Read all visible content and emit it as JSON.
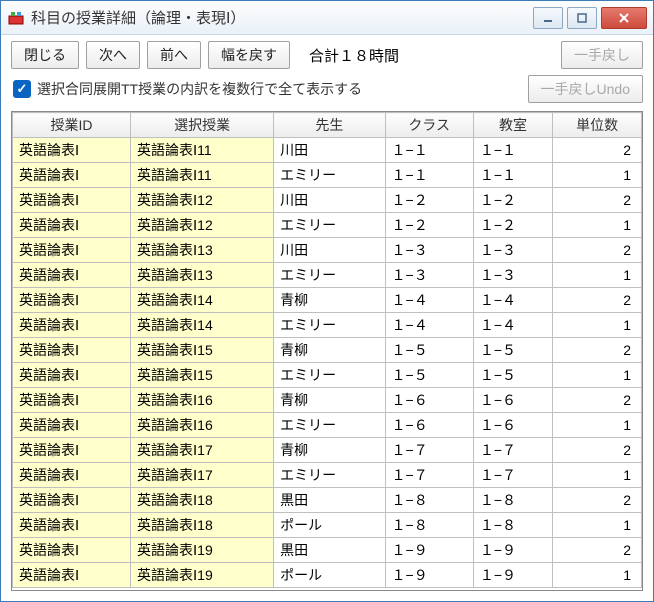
{
  "window": {
    "title": "科目の授業詳細（論理・表現Ⅰ）"
  },
  "toolbar": {
    "close": "閉じる",
    "next": "次へ",
    "prev": "前へ",
    "reset_width": "幅を戻す",
    "summary": "合計１８時間",
    "undo1": "一手戻し",
    "undo2": "一手戻しUndo"
  },
  "checkbox": {
    "label": "選択合同展開TT授業の内訳を複数行で全て表示する"
  },
  "table": {
    "headers": [
      "授業ID",
      "選択授業",
      "先生",
      "クラス",
      "教室",
      "単位数"
    ],
    "rows": [
      [
        "英語論表Ⅰ",
        "英語論表Ⅰ11",
        "川田",
        "１−１",
        "１−１",
        "2"
      ],
      [
        "英語論表Ⅰ",
        "英語論表Ⅰ11",
        "エミリー",
        "１−１",
        "１−１",
        "1"
      ],
      [
        "英語論表Ⅰ",
        "英語論表Ⅰ12",
        "川田",
        "１−２",
        "１−２",
        "2"
      ],
      [
        "英語論表Ⅰ",
        "英語論表Ⅰ12",
        "エミリー",
        "１−２",
        "１−２",
        "1"
      ],
      [
        "英語論表Ⅰ",
        "英語論表Ⅰ13",
        "川田",
        "１−３",
        "１−３",
        "2"
      ],
      [
        "英語論表Ⅰ",
        "英語論表Ⅰ13",
        "エミリー",
        "１−３",
        "１−３",
        "1"
      ],
      [
        "英語論表Ⅰ",
        "英語論表Ⅰ14",
        "青柳",
        "１−４",
        "１−４",
        "2"
      ],
      [
        "英語論表Ⅰ",
        "英語論表Ⅰ14",
        "エミリー",
        "１−４",
        "１−４",
        "1"
      ],
      [
        "英語論表Ⅰ",
        "英語論表Ⅰ15",
        "青柳",
        "１−５",
        "１−５",
        "2"
      ],
      [
        "英語論表Ⅰ",
        "英語論表Ⅰ15",
        "エミリー",
        "１−５",
        "１−５",
        "1"
      ],
      [
        "英語論表Ⅰ",
        "英語論表Ⅰ16",
        "青柳",
        "１−６",
        "１−６",
        "2"
      ],
      [
        "英語論表Ⅰ",
        "英語論表Ⅰ16",
        "エミリー",
        "１−６",
        "１−６",
        "1"
      ],
      [
        "英語論表Ⅰ",
        "英語論表Ⅰ17",
        "青柳",
        "１−７",
        "１−７",
        "2"
      ],
      [
        "英語論表Ⅰ",
        "英語論表Ⅰ17",
        "エミリー",
        "１−７",
        "１−７",
        "1"
      ],
      [
        "英語論表Ⅰ",
        "英語論表Ⅰ18",
        "黒田",
        "１−８",
        "１−８",
        "2"
      ],
      [
        "英語論表Ⅰ",
        "英語論表Ⅰ18",
        "ポール",
        "１−８",
        "１−８",
        "1"
      ],
      [
        "英語論表Ⅰ",
        "英語論表Ⅰ19",
        "黒田",
        "１−９",
        "１−９",
        "2"
      ],
      [
        "英語論表Ⅰ",
        "英語論表Ⅰ19",
        "ポール",
        "１−９",
        "１−９",
        "1"
      ]
    ]
  }
}
